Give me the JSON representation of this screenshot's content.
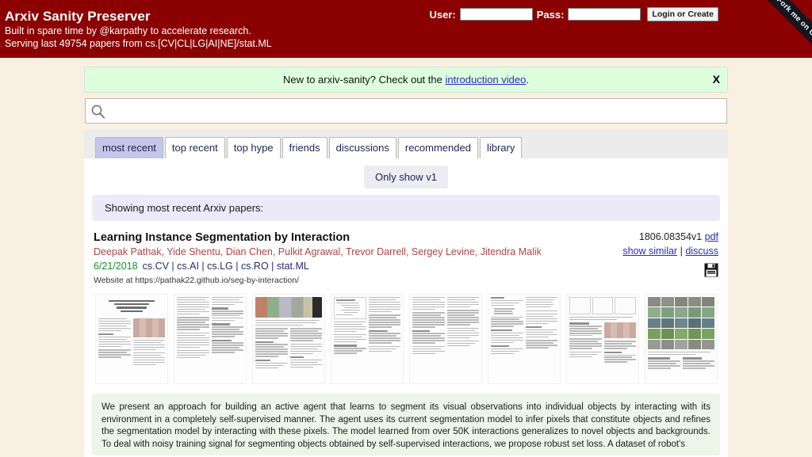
{
  "header": {
    "title": "Arxiv Sanity Preserver",
    "subtitle1": "Built in spare time by @karpathy to accelerate research.",
    "subtitle2": "Serving last 49754 papers from cs.[CV|CL|LG|AI|NE]/stat.ML",
    "user_label": "User:",
    "pass_label": "Pass:",
    "user_value": "",
    "pass_value": "",
    "user_placeholder": "",
    "pass_placeholder": "",
    "login_button": "Login or Create",
    "ribbon": "Fork me on GitHub",
    "bg_color": "#8b0000"
  },
  "notice": {
    "text_before": "New to arxiv-sanity? Check out the ",
    "link_text": "introduction video",
    "text_after": ".",
    "close_label": "X",
    "bg_color": "#ddffdd"
  },
  "search": {
    "value": "",
    "placeholder": "",
    "icon": "search-icon"
  },
  "tabs": [
    {
      "label": "most recent",
      "active": true
    },
    {
      "label": "top recent",
      "active": false
    },
    {
      "label": "top hype",
      "active": false
    },
    {
      "label": "friends",
      "active": false
    },
    {
      "label": "discussions",
      "active": false
    },
    {
      "label": "recommended",
      "active": false
    },
    {
      "label": "library",
      "active": false
    }
  ],
  "filter": {
    "only_v1_label": "Only show v1"
  },
  "showing_banner": {
    "text": "Showing most recent Arxiv papers:",
    "bg_color": "#eceaf8"
  },
  "paper": {
    "title": "Learning Instance Segmentation by Interaction",
    "authors": "Deepak Pathak, Yide Shentu, Dian Chen, Pulkit Agrawal, Trevor Darrell, Sergey Levine, Jitendra Malik",
    "date": "6/21/2018",
    "categories": "cs.CV | cs.AI | cs.LG | cs.RO | stat.ML",
    "website": "Website at https://pathak22.github.io/seg-by-interaction/",
    "arxiv_id": "1806.08354v1",
    "pdf_label": "pdf",
    "show_similar_label": "show similar",
    "separator": "|",
    "discuss_label": "discuss",
    "save_icon": "floppy-disk-icon",
    "authors_color": "#b24444",
    "date_color": "#17912b",
    "categories_color": "#2a2a6d",
    "abstract": "We present an approach for building an active agent that learns to segment its visual observations into individual objects by interacting with its environment in a completely self-supervised manner. The agent uses its current segmentation model to infer pixels that constitute objects and refines the segmentation model by interacting with these pixels. The model learned from over 50K interactions generalizes to novel objects and backgrounds. To deal with noisy training signal for segmenting objects obtained by self-supervised interactions, we propose robust set loss. A dataset of robot's",
    "thumbnails": [
      "page-1-thumbnail",
      "page-2-thumbnail",
      "page-3-thumbnail",
      "page-4-thumbnail",
      "page-5-thumbnail",
      "page-6-thumbnail",
      "page-7-thumbnail",
      "page-8-thumbnail"
    ]
  }
}
